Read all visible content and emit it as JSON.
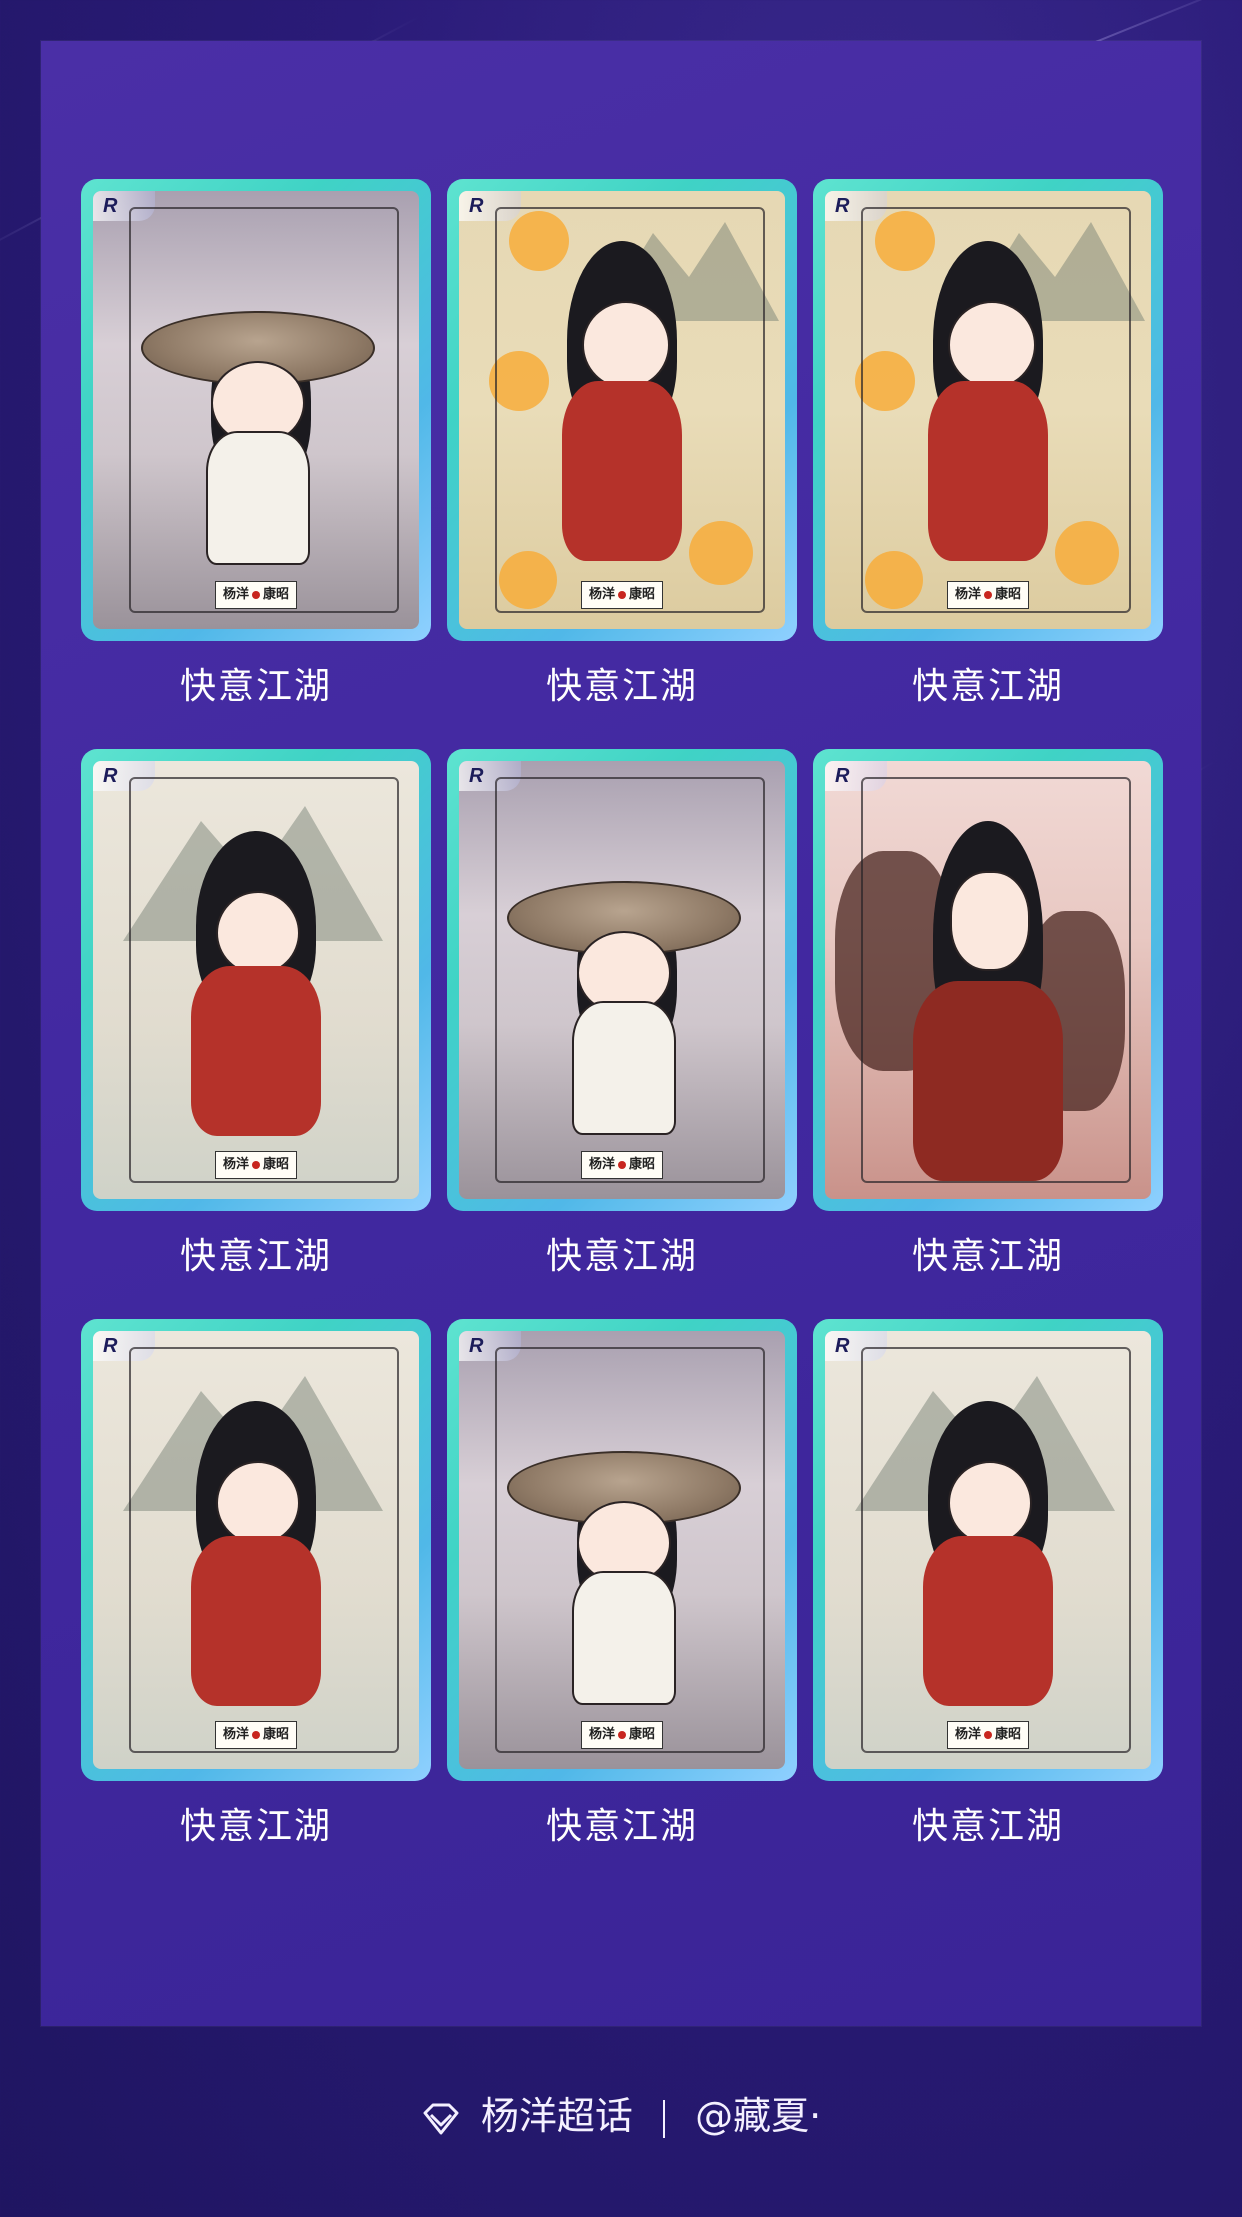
{
  "cards": [
    {
      "label": "快意江湖",
      "rarity": "R",
      "style": "a"
    },
    {
      "label": "快意江湖",
      "rarity": "R",
      "style": "b"
    },
    {
      "label": "快意江湖",
      "rarity": "R",
      "style": "b"
    },
    {
      "label": "快意江湖",
      "rarity": "R",
      "style": "c"
    },
    {
      "label": "快意江湖",
      "rarity": "R",
      "style": "a"
    },
    {
      "label": "快意江湖",
      "rarity": "R",
      "style": "d"
    },
    {
      "label": "快意江湖",
      "rarity": "R",
      "style": "c"
    },
    {
      "label": "快意江湖",
      "rarity": "R",
      "style": "a"
    },
    {
      "label": "快意江湖",
      "rarity": "R",
      "style": "c"
    }
  ],
  "seal_text": "杨洋 康昭",
  "footer": {
    "icon": "diamond-icon",
    "topic": "杨洋超话",
    "author": "@藏夏·"
  },
  "colors": {
    "background": "#2a1b78",
    "panel": "#4128a0",
    "card_border": "#3fd3c5",
    "text": "#ffffff"
  }
}
